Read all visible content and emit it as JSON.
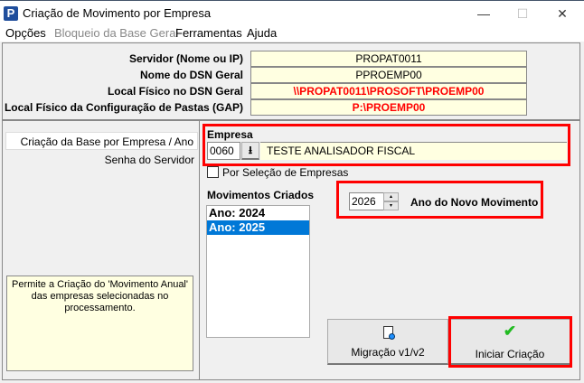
{
  "window": {
    "title": "Criação de Movimento por Empresa",
    "minimize": "—",
    "maximize": "☐",
    "close": "✕",
    "icon_letter": "P"
  },
  "menu": [
    "Opções",
    "Bloqueio da Base Geral",
    "Ferramentas",
    "Ajuda"
  ],
  "config": [
    {
      "label": "Servidor (Nome ou IP)",
      "value": "PROPAT0011"
    },
    {
      "label": "Nome do DSN Geral",
      "value": "PPROEMP00"
    },
    {
      "label": "Local Físico no DSN Geral",
      "value": "\\\\PROPAT0011\\PROSOFT\\PROEMP00"
    },
    {
      "label": "Local Físico da Configuração de Pastas (GAP)",
      "value": "P:\\PROEMP00"
    }
  ],
  "nav": [
    "Criação da Base por Empresa / Ano",
    "Senha do Servidor"
  ],
  "info": "Permite a Criação do 'Movimento Anual' das empresas selecionadas no processamento.",
  "empresa": {
    "label": "Empresa",
    "code": "0060",
    "name": "TESTE ANALISADOR FISCAL",
    "lookup_icon": "⭳"
  },
  "selecao": {
    "label": "Por Seleção de Empresas",
    "checked": false
  },
  "movimentos": {
    "label": "Movimentos Criados",
    "items": [
      "Ano: 2024",
      "Ano: 2025"
    ],
    "selected": 1
  },
  "ano": {
    "value": "2026",
    "label": "Ano do Novo Movimento"
  },
  "buttons": {
    "migracao": "Migração v1/v2",
    "iniciar": "Iniciar Criação"
  },
  "colors": {
    "accent": "#0078d7",
    "highlight": "#ff0000",
    "field": "#ffffe1"
  }
}
